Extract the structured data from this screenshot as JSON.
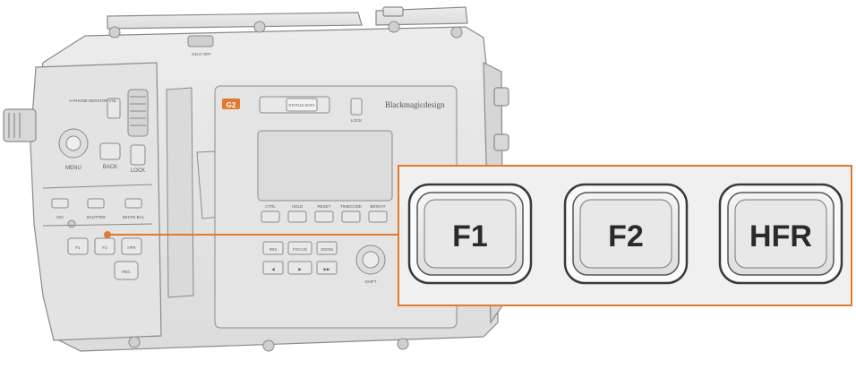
{
  "callout": {
    "buttons": [
      {
        "label": "F1"
      },
      {
        "label": "F2"
      },
      {
        "label": "HFR"
      }
    ]
  },
  "camera": {
    "brand": "Blackmagicdesign",
    "model_badge": "G2",
    "power_switch": "ON  O  OFF",
    "left_panel": {
      "headphone_label": "H PHONE\nMONITOR\nVOL",
      "menu": "MENU",
      "back": "BACK",
      "lock": "LOCK",
      "small_buttons": [
        "F1",
        "F2",
        "HFR"
      ],
      "iso": "ISO",
      "shutter": "SHUTTER",
      "white_bal": "WHITE BAL",
      "rec": "REC"
    },
    "side_panel": {
      "lock": "LOCK",
      "status_button": "STATUS\nDATA",
      "soft_keys": [
        "CTRL",
        "HOLD",
        "RESET",
        "TIMECODE",
        "BRIGHT",
        ""
      ],
      "transport_top": [
        "IRIS",
        "FOCUS",
        "ZOOM"
      ],
      "transport_bottom": [
        "◀",
        "▶",
        "▶▶"
      ],
      "jog": "SHIFT"
    }
  },
  "colors": {
    "accent": "#e07a30",
    "body_fill": "#e6e6e6",
    "stroke": "#8a8a8a",
    "callout_fill": "#f0f0f0"
  }
}
